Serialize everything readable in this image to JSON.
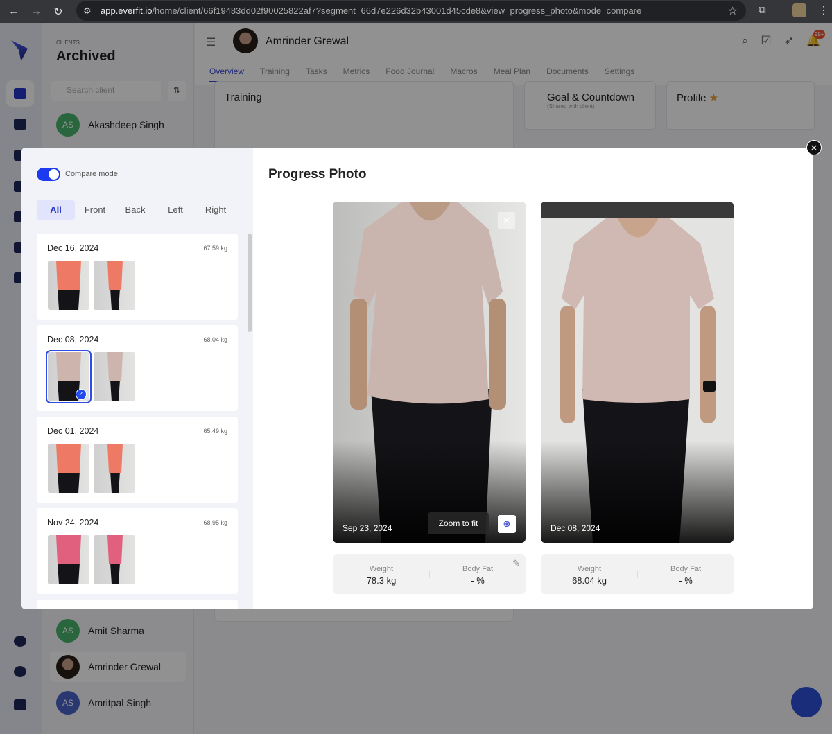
{
  "browser": {
    "url_host": "app.everfit.io",
    "url_path": "/home/client/66f19483dd02f90025822af7?segment=66d7e226d32b43001d45cde8&view=progress_photo&mode=compare"
  },
  "clients_panel": {
    "label": "CLIENTS",
    "title": "Archived",
    "search_placeholder": "Search client",
    "clients": [
      {
        "initials": "AS",
        "name": "Akashdeep Singh"
      },
      {
        "initials": "AS",
        "name": "Amit Sharma"
      },
      {
        "initials": "",
        "name": "Amrinder Grewal"
      },
      {
        "initials": "AS",
        "name": "Amritpal Singh"
      }
    ]
  },
  "header": {
    "client_name": "Amrinder Grewal",
    "tabs": [
      "Overview",
      "Training",
      "Tasks",
      "Metrics",
      "Food Journal",
      "Macros",
      "Meal Plan",
      "Documents",
      "Settings"
    ],
    "notification_badge": "99+"
  },
  "cards": {
    "training": "Training",
    "goal": "Goal & Countdown",
    "goal_sub": "(Shared with client)",
    "profile": "Profile"
  },
  "modal": {
    "compare_mode_label": "Compare mode",
    "compare_mode_on": true,
    "filters": [
      "All",
      "Front",
      "Back",
      "Left",
      "Right"
    ],
    "active_filter": "All",
    "sessions": [
      {
        "date": "Dec 16, 2024",
        "weight": "67.59 kg",
        "shirt": "#ee7a66"
      },
      {
        "date": "Dec 08, 2024",
        "weight": "68.04 kg",
        "shirt": "#cdb4ad"
      },
      {
        "date": "Dec 01, 2024",
        "weight": "65.49 kg",
        "shirt": "#ee7a66"
      },
      {
        "date": "Nov 24, 2024",
        "weight": "68.95 kg",
        "shirt": "#e0607e"
      }
    ],
    "title": "Progress Photo",
    "zoom_to_fit": "Zoom to fit",
    "photos": [
      {
        "date": "Sep 23, 2024",
        "weight_label": "Weight",
        "weight": "78.3 kg",
        "bodyfat_label": "Body Fat",
        "bodyfat": "- %"
      },
      {
        "date": "Dec 08, 2024",
        "weight_label": "Weight",
        "weight": "68.04 kg",
        "bodyfat_label": "Body Fat",
        "bodyfat": "- %"
      }
    ]
  }
}
